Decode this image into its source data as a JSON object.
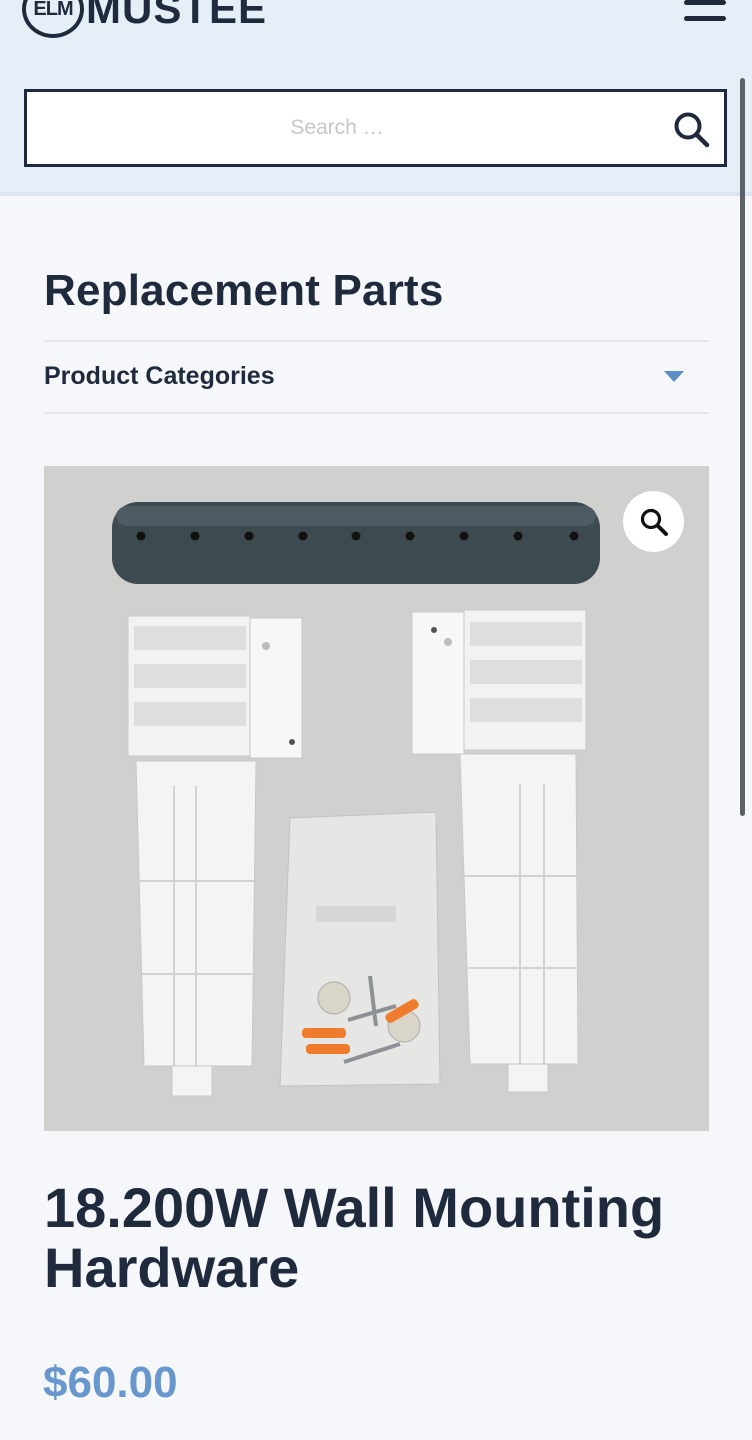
{
  "header": {
    "logo_badge": "ELM",
    "logo_text": "MUSTEE",
    "menu_icon": "hamburger-menu-icon",
    "background_color": "#e6eef7"
  },
  "search": {
    "placeholder": "Search …",
    "value": "",
    "icon": "search-icon"
  },
  "page": {
    "title": "Replacement Parts"
  },
  "categories": {
    "label": "Product Categories",
    "toggle_icon": "caret-down-icon",
    "accent_color": "#5a8ec4"
  },
  "product": {
    "title": "18.200W Wall Mounting Hardware",
    "price": "$60.00",
    "price_color": "#6797cc",
    "zoom_icon": "magnifier-zoom-icon",
    "image_subject": "wall-mounting-hardware-kit-photo"
  },
  "colors": {
    "text": "#1f2b3d",
    "background": "#f5f7fa"
  }
}
